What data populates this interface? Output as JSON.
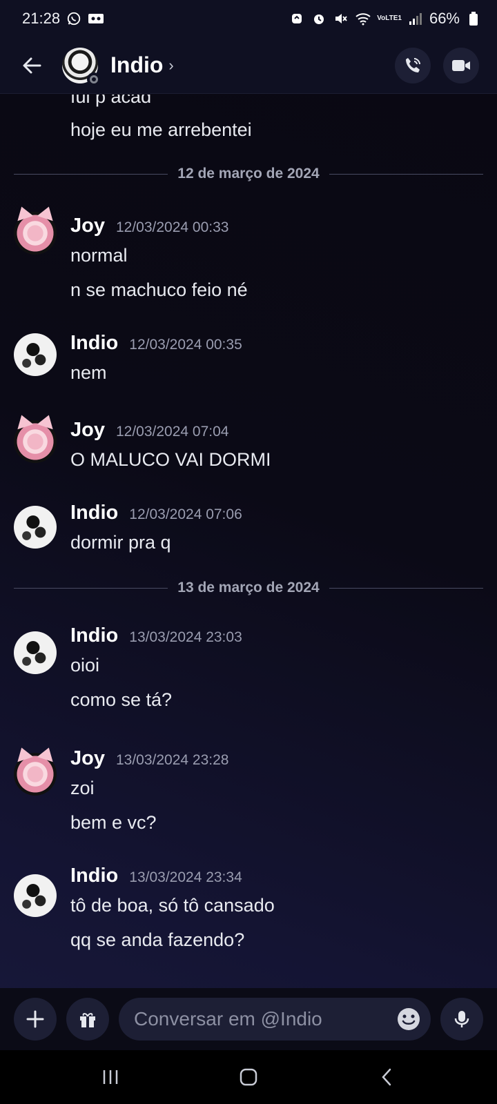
{
  "status_bar": {
    "time": "21:28",
    "battery": "66%",
    "network_label": "VoLTE1"
  },
  "header": {
    "contact_name": "Indio",
    "chevron": "›",
    "back_icon": "arrow-left-icon",
    "call_icon": "phone-call-icon",
    "video_icon": "video-camera-icon"
  },
  "messages_top": [
    "fui p acad",
    "hoje eu me arrebentei"
  ],
  "dividers": [
    "12 de março de 2024",
    "13 de março de 2024"
  ],
  "groups": [
    {
      "author": "Joy",
      "time": "12/03/2024 00:33",
      "lines": [
        "normal",
        "n se machuco feio né"
      ]
    },
    {
      "author": "Indio",
      "time": "12/03/2024 00:35",
      "lines": [
        "nem"
      ]
    },
    {
      "author": "Joy",
      "time": "12/03/2024 07:04",
      "lines": [
        "O MALUCO VAI DORMI"
      ]
    },
    {
      "author": "Indio",
      "time": "12/03/2024 07:06",
      "lines": [
        "dormir pra q"
      ]
    },
    {
      "author": "Indio",
      "time": "13/03/2024 23:03",
      "lines": [
        "oioi",
        "como se tá?"
      ]
    },
    {
      "author": "Joy",
      "time": "13/03/2024 23:28",
      "lines": [
        "zoi",
        "bem e vc?"
      ]
    },
    {
      "author": "Indio",
      "time": "13/03/2024 23:34",
      "lines": [
        "tô de boa, só tô cansado",
        "qq se anda fazendo?"
      ]
    }
  ],
  "composer": {
    "placeholder": "Conversar em @Indio",
    "value": ""
  },
  "colors": {
    "background_top": "#0a0812",
    "background_bottom": "#191a3c",
    "bar": "#0f1022",
    "button": "#1d1f35"
  }
}
